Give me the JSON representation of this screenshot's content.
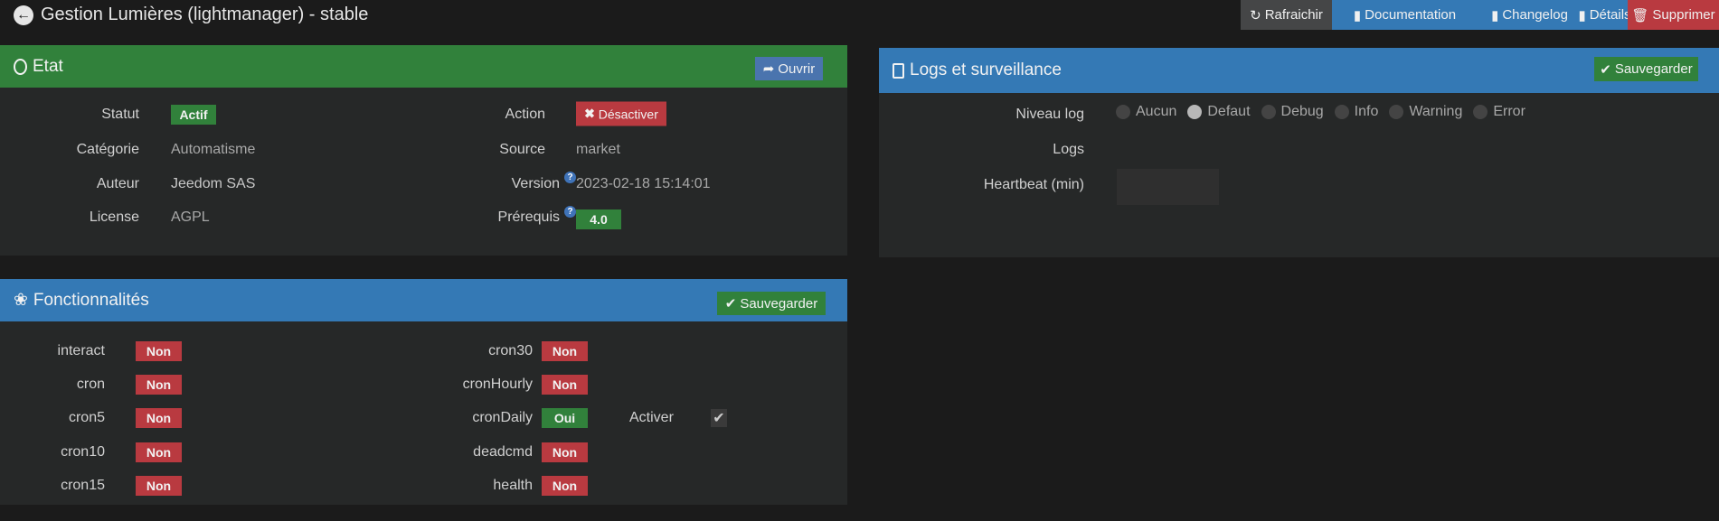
{
  "header": {
    "title": "Gestion Lumières (lightmanager) - stable",
    "buttons": {
      "refresh": "Rafraichir",
      "documentation": "Documentation",
      "changelog": "Changelog",
      "details": "Détails",
      "delete": "Supprimer"
    }
  },
  "etat": {
    "title": "Etat",
    "open_label": "Ouvrir",
    "statut_label": "Statut",
    "statut_value": "Actif",
    "categorie_label": "Catégorie",
    "categorie_value": "Automatisme",
    "auteur_label": "Auteur",
    "auteur_value": "Jeedom SAS",
    "license_label": "License",
    "license_value": "AGPL",
    "action_label": "Action",
    "action_value": "Désactiver",
    "source_label": "Source",
    "source_value": "market",
    "version_label": "Version",
    "version_value": "2023-02-18 15:14:01",
    "prereq_label": "Prérequis",
    "prereq_value": "4.0"
  },
  "logs": {
    "title": "Logs et surveillance",
    "save_label": "Sauvegarder",
    "level_label": "Niveau log",
    "levels": [
      "Aucun",
      "Defaut",
      "Debug",
      "Info",
      "Warning",
      "Error"
    ],
    "selected_level": "Defaut",
    "logs_label": "Logs",
    "heartbeat_label": "Heartbeat (min)",
    "heartbeat_value": ""
  },
  "features": {
    "title": "Fonctionnalités",
    "save_label": "Sauvegarder",
    "col1": [
      {
        "name": "interact",
        "value": "Non"
      },
      {
        "name": "cron",
        "value": "Non"
      },
      {
        "name": "cron5",
        "value": "Non"
      },
      {
        "name": "cron10",
        "value": "Non"
      },
      {
        "name": "cron15",
        "value": "Non"
      }
    ],
    "col2": [
      {
        "name": "cron30",
        "value": "Non"
      },
      {
        "name": "cronHourly",
        "value": "Non"
      },
      {
        "name": "cronDaily",
        "value": "Oui"
      },
      {
        "name": "deadcmd",
        "value": "Non"
      },
      {
        "name": "health",
        "value": "Non"
      }
    ],
    "activer_label": "Activer",
    "activer_checked": true
  },
  "colors": {
    "green": "#31813b",
    "red": "#b93a40",
    "blue": "#3479b5",
    "panel": "#262828"
  }
}
